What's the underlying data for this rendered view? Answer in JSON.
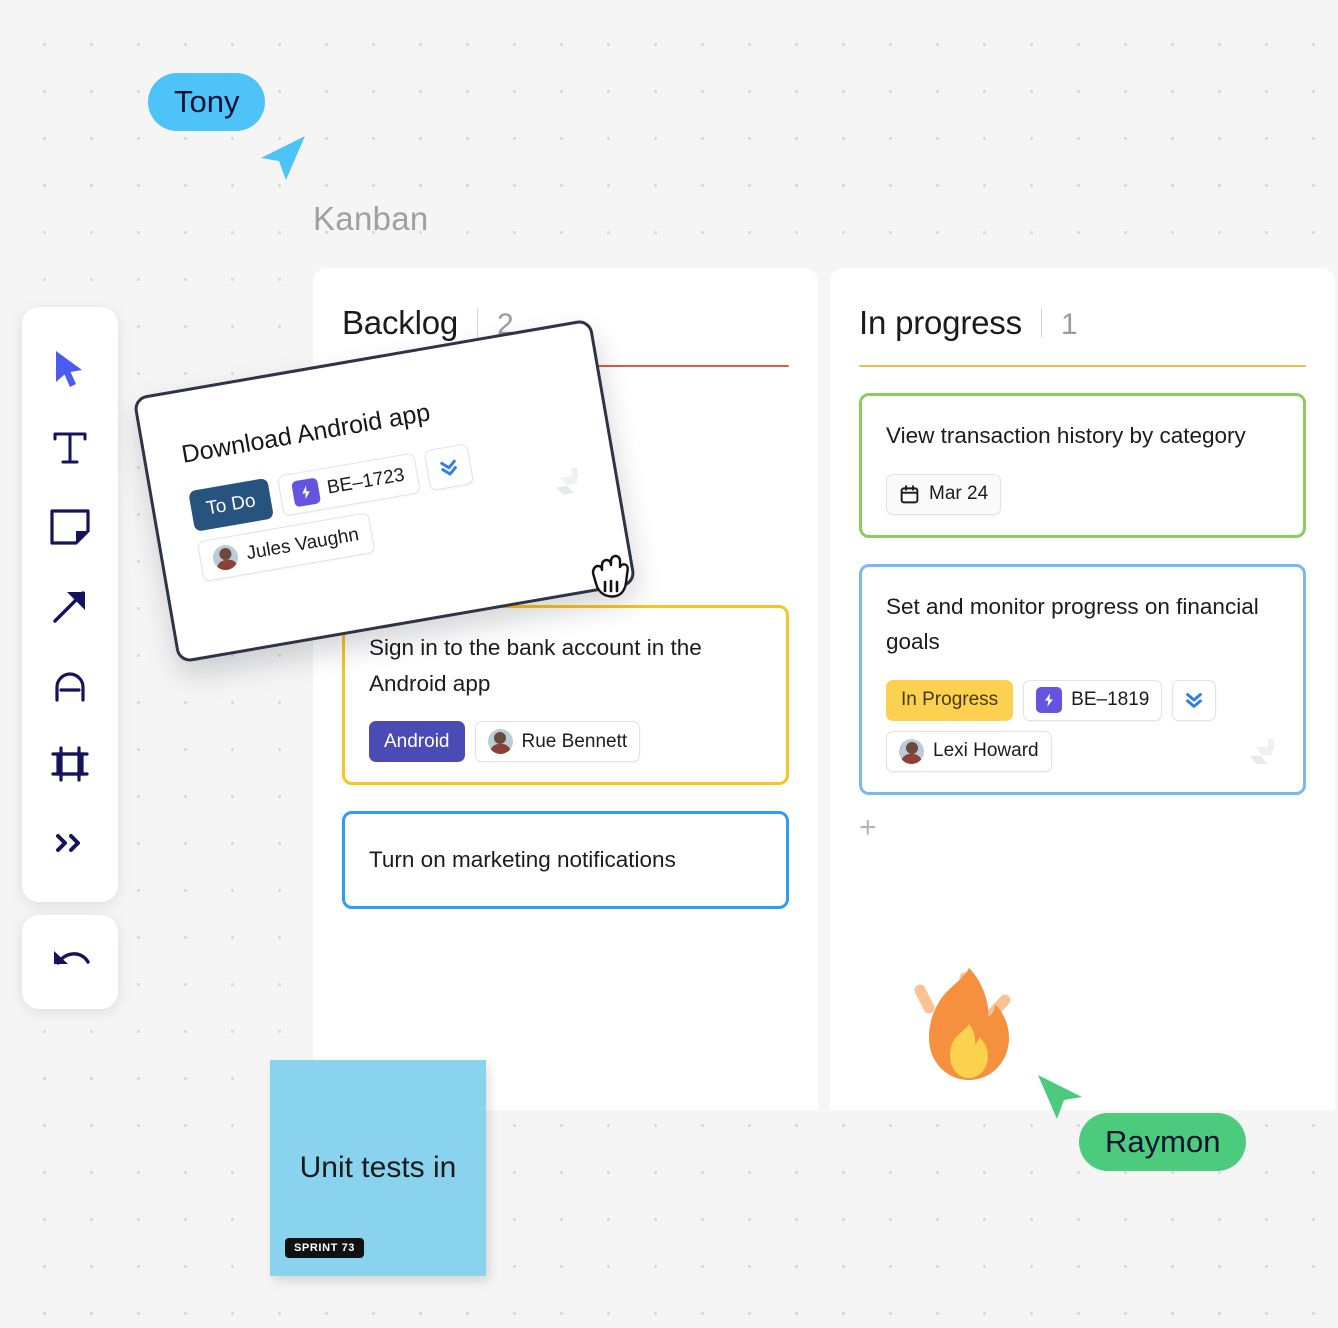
{
  "canvas": {
    "label": "Kanban",
    "background": "#f5f5f5",
    "dot_color": "#d8d8d8"
  },
  "toolbar": {
    "tools": [
      {
        "name": "select-tool",
        "icon": "cursor-arrow-icon"
      },
      {
        "name": "text-tool",
        "icon": "text-t-icon"
      },
      {
        "name": "sticky-note-tool",
        "icon": "sticky-note-icon"
      },
      {
        "name": "arrow-tool",
        "icon": "arrow-up-right-icon"
      },
      {
        "name": "shape-tool",
        "icon": "shape-a-icon"
      },
      {
        "name": "frame-tool",
        "icon": "frame-icon"
      },
      {
        "name": "more-tools",
        "icon": "double-chevron-right-icon"
      }
    ],
    "undo": {
      "name": "undo-button",
      "icon": "undo-arrow-icon"
    }
  },
  "cursors": [
    {
      "name": "Tony",
      "color": "#4ec3f7",
      "text_color": "#0d1136"
    },
    {
      "name": "Raymon",
      "color": "#4ccb7d",
      "text_color": "#0d1136"
    }
  ],
  "board": {
    "columns": [
      {
        "title": "Backlog",
        "count": "2",
        "rule_color": "#e05b3f",
        "cards": [
          {
            "title": "Sign in to the bank account in the Android app",
            "border_color": "#f7c325",
            "chips": [
              {
                "type": "tag",
                "label": "Android",
                "bg": "#4b4bb5",
                "fg": "#ffffff"
              },
              {
                "type": "assignee",
                "label": "Rue Bennett"
              }
            ]
          },
          {
            "title": "Turn on marketing notifications",
            "border_color": "#2d9cf5",
            "chips": []
          }
        ]
      },
      {
        "title": "In progress",
        "count": "1",
        "rule_color": "#eac244",
        "add_label": "+",
        "cards": [
          {
            "title": "View transaction history by category",
            "border_color": "#8ccc5b",
            "chips": [
              {
                "type": "date",
                "label": "Mar 24"
              }
            ]
          },
          {
            "title": "Set and monitor progress on financial goals",
            "border_color": "#77b9f2",
            "watermark": "jira-logo-icon",
            "chips": [
              {
                "type": "status",
                "label": "In Progress",
                "bg": "#fbd14f",
                "fg": "#4a3a07"
              },
              {
                "type": "issue",
                "label": "BE–1819"
              },
              {
                "type": "priority",
                "label": "",
                "icon": "priority-highest-icon"
              },
              {
                "type": "assignee",
                "label": "Lexi Howard"
              }
            ]
          }
        ]
      }
    ]
  },
  "dragged_card": {
    "title": "Download Android app",
    "watermark": "jira-logo-icon",
    "cursor": "grabbing-hand-icon",
    "chips": [
      {
        "type": "status",
        "label": "To Do",
        "bg": "#27537f",
        "fg": "#ffffff"
      },
      {
        "type": "issue",
        "label": "BE–1723"
      },
      {
        "type": "priority",
        "label": "",
        "icon": "priority-highest-icon"
      },
      {
        "type": "assignee",
        "label": "Jules Vaughn"
      }
    ]
  },
  "sticky_note": {
    "text": "Unit tests in",
    "color": "#89d3ef",
    "badge": "SPRINT 73"
  },
  "sticker": {
    "name": "fire-emoji-sticker"
  }
}
